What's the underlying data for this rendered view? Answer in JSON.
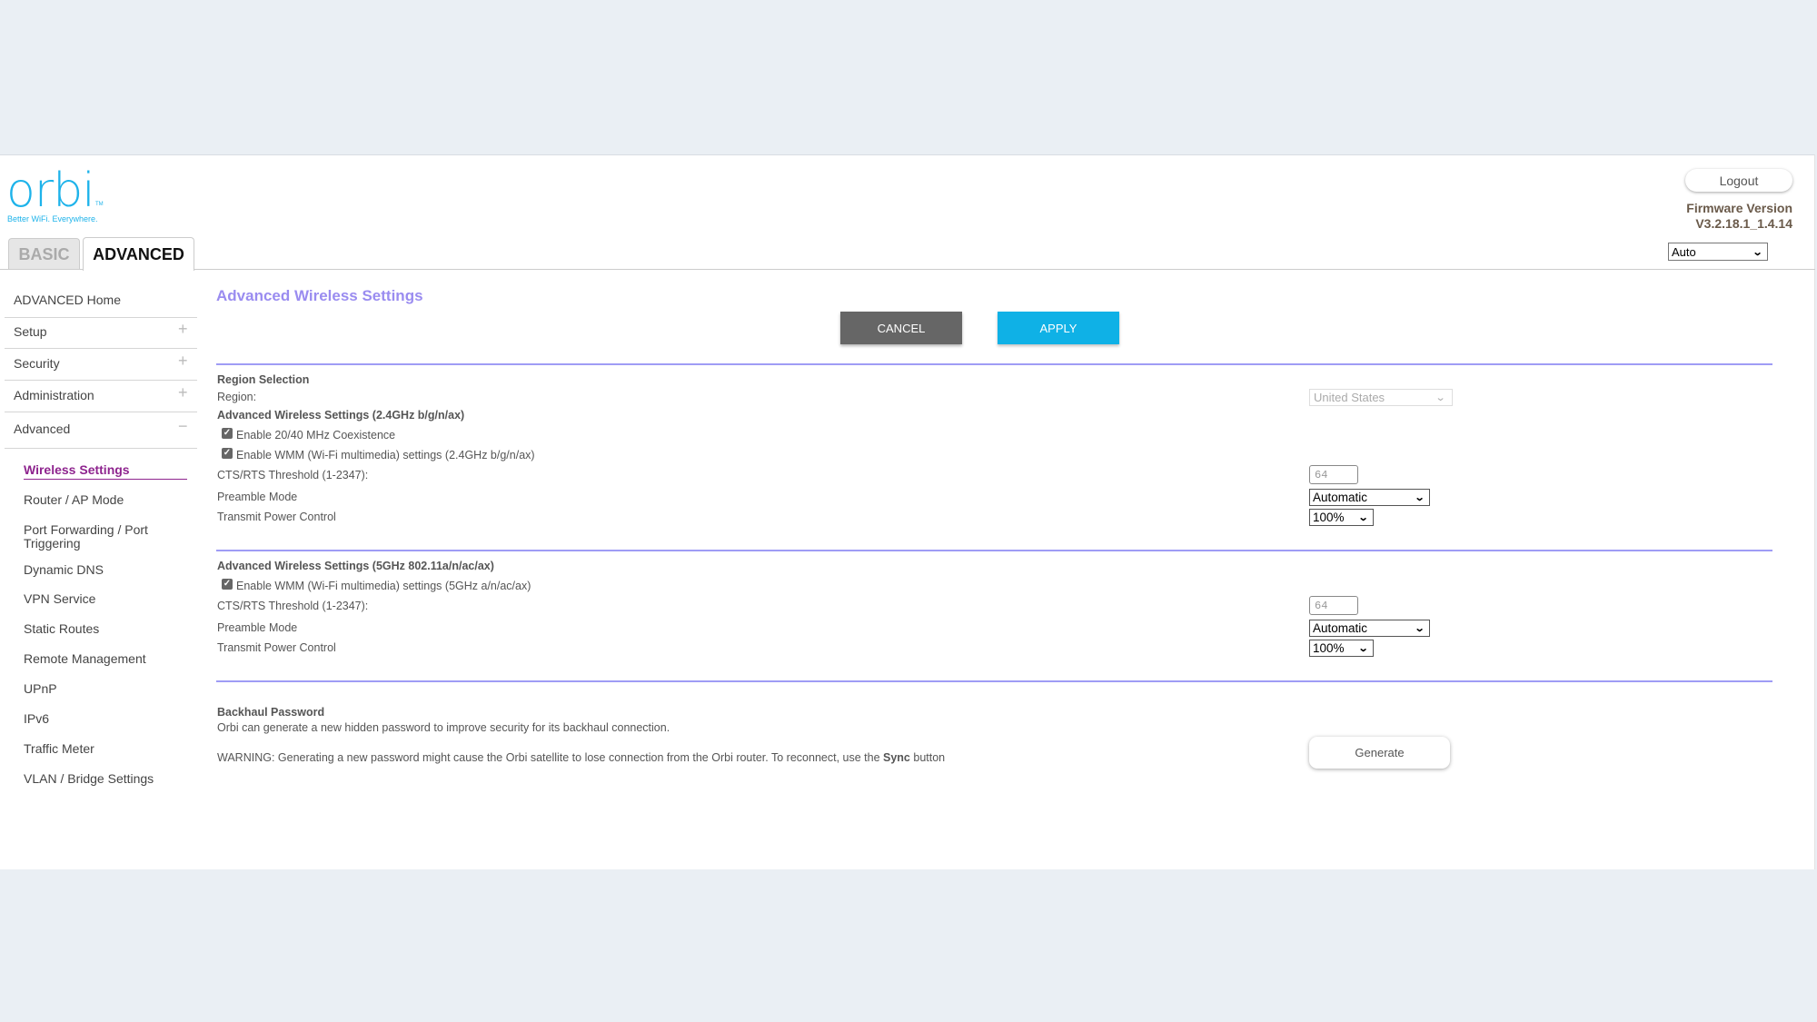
{
  "brand": {
    "logo_text": "orbi",
    "logo_tm": "TM",
    "tagline": "Better WiFi. Everywhere.",
    "color": "#1eb3ea"
  },
  "tabs": [
    {
      "label": "BASIC",
      "active": false
    },
    {
      "label": "ADVANCED",
      "active": true
    }
  ],
  "header": {
    "logout_label": "Logout",
    "firmware_label": "Firmware Version",
    "firmware_value": "V3.2.18.1_1.4.14",
    "language_select": "Auto"
  },
  "sidebar": {
    "items": [
      {
        "label": "ADVANCED Home",
        "sign": ""
      },
      {
        "label": "Setup",
        "sign": "+"
      },
      {
        "label": "Security",
        "sign": "+"
      },
      {
        "label": "Administration",
        "sign": "+"
      },
      {
        "label": "Advanced",
        "sign": "−"
      }
    ],
    "sub_items": [
      {
        "label": "Wireless Settings",
        "active": true
      },
      {
        "label": "Router / AP Mode"
      },
      {
        "label": "Port Forwarding / Port Triggering"
      },
      {
        "label": "Dynamic DNS"
      },
      {
        "label": "VPN Service"
      },
      {
        "label": "Static Routes"
      },
      {
        "label": "Remote Management"
      },
      {
        "label": "UPnP"
      },
      {
        "label": "IPv6"
      },
      {
        "label": "Traffic Meter"
      },
      {
        "label": "VLAN / Bridge Settings"
      }
    ]
  },
  "main": {
    "title": "Advanced Wireless Settings",
    "cancel_label": "CANCEL",
    "apply_label": "APPLY",
    "region": {
      "heading": "Region Selection",
      "label": "Region:",
      "value": "United States"
    },
    "band_24": {
      "heading": "Advanced Wireless Settings (2.4GHz b/g/n/ax)",
      "coexistence_label": "Enable 20/40 MHz Coexistence",
      "coexistence_checked": true,
      "wmm_label": "Enable WMM (Wi-Fi multimedia) settings (2.4GHz b/g/n/ax)",
      "wmm_checked": true,
      "cts_label": "CTS/RTS Threshold (1-2347):",
      "cts_value": "64",
      "preamble_label": "Preamble Mode",
      "preamble_value": "Automatic",
      "power_label": "Transmit Power Control",
      "power_value": "100%"
    },
    "band_5": {
      "heading": "Advanced Wireless Settings (5GHz 802.11a/n/ac/ax)",
      "wmm_label": "Enable WMM (Wi-Fi multimedia) settings (5GHz a/n/ac/ax)",
      "wmm_checked": true,
      "cts_label": "CTS/RTS Threshold (1-2347):",
      "cts_value": "64",
      "preamble_label": "Preamble Mode",
      "preamble_value": "Automatic",
      "power_label": "Transmit Power Control",
      "power_value": "100%"
    },
    "backhaul": {
      "heading": "Backhaul Password",
      "description": "Orbi can generate a new hidden password to improve security for its backhaul connection.",
      "warning_prefix": "WARNING: Generating a new password might cause the Orbi satellite to lose connection from the Orbi router. To reconnect, use the ",
      "warning_bold": "Sync",
      "warning_suffix": " button",
      "generate_label": "Generate"
    }
  },
  "icons": {
    "chevron_down": "⌄",
    "check": "✓"
  },
  "colors": {
    "accent_blue": "#0fb1e6",
    "cancel_gray": "#666666",
    "title_purple": "#9a8cf0",
    "separator": "#9f9cf5",
    "active_link": "#8e248e"
  }
}
